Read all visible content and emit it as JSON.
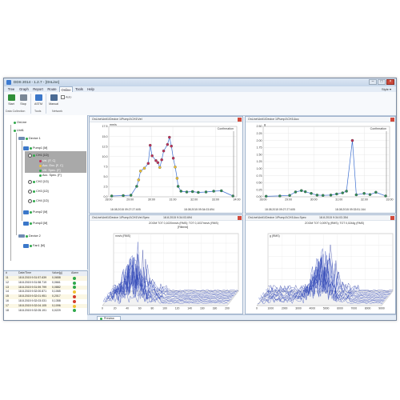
{
  "window": {
    "title": "DDS 2014 - 1.2.7 - [OnLine]",
    "controls": {
      "minimize": "–",
      "maximize": "□",
      "close": "×"
    }
  },
  "menu": {
    "tabs": [
      "Tree",
      "Graph",
      "Report",
      "Route",
      "Online",
      "Tools",
      "Help"
    ],
    "active": "Online",
    "style_label": "Style"
  },
  "ribbon": {
    "buttons": [
      {
        "label": "Start",
        "icon": "play-icon",
        "color": "#2f8f3a"
      },
      {
        "label": "Stop",
        "icon": "stop-icon",
        "color": "#7a8796"
      },
      {
        "label": "ASTM",
        "icon": "astm-icon",
        "color": "#3b77c9"
      },
      {
        "label": "Manual",
        "icon": "manual-icon",
        "color": "#4a6b94"
      }
    ],
    "auto_label": "Auto",
    "groups": [
      "Data Collection",
      "Tools",
      "Network"
    ]
  },
  "tree": {
    "nodes": [
      {
        "label": "OnLine",
        "level": 0
      },
      {
        "label": "Unit1",
        "level": 1
      },
      {
        "label": "Device 1",
        "level": 2
      },
      {
        "label": "Pump1 [M]",
        "level": 3
      },
      {
        "label": "CH1 [1D]",
        "level": 4
      },
      {
        "label": "Vel. [F, C]",
        "level": 5
      },
      {
        "label": "Acc. Env. [F, C]",
        "level": 5
      },
      {
        "label": "Vel. Spec. [F]",
        "level": 5
      },
      {
        "label": "Acc. Spec. [F]",
        "level": 5
      },
      {
        "label": "CH2 [1D]",
        "level": 4
      },
      {
        "label": "CH3 [1D]",
        "level": 4
      },
      {
        "label": "CH4 [1D]",
        "level": 4
      },
      {
        "label": "Pump2 [M]",
        "level": 3
      },
      {
        "label": "Pump3 [M]",
        "level": 3
      },
      {
        "label": "Device 2",
        "level": 2
      },
      {
        "label": "Fan1 [M]",
        "level": 3
      }
    ]
  },
  "alarm_table": {
    "headers": [
      "#",
      "Date/Time",
      "Value[g]",
      "Alarm"
    ],
    "rows": [
      {
        "n": "11",
        "time": "18.8.2015 9:31:57.639",
        "value": "0,0658",
        "color": "#2fa84a"
      },
      {
        "n": "12",
        "time": "18.8.2015 9:31:58.719",
        "value": "0,0661",
        "color": "#2fa84a"
      },
      {
        "n": "13",
        "time": "18.8.2015 9:31:59.799",
        "value": "0,0882",
        "color": "#2fa84a"
      },
      {
        "n": "14",
        "time": "18.8.2015 9:32:00.871",
        "value": "0,1065",
        "color": "#f1c232"
      },
      {
        "n": "15",
        "time": "18.8.2015 9:32:01.951",
        "value": "0,2017",
        "color": "#d33a2c"
      },
      {
        "n": "16",
        "time": "18.8.2015 9:32:03.031",
        "value": "0,1358",
        "color": "#d33a2c"
      },
      {
        "n": "17",
        "time": "18.8.2015 9:32:04.105",
        "value": "0,1096",
        "color": "#f1c232"
      },
      {
        "n": "18",
        "time": "18.8.2015 9:32:05.191",
        "value": "0,0229",
        "color": "#2fa84a"
      }
    ]
  },
  "panels": {
    "vel_trend": {
      "title": "OnLine\\Unit1\\Device 1\\Pump1\\CH1\\Vel",
      "from": "18.08.2015 09:27:27.605",
      "to": "18.08.2015 09:34:03.694",
      "annotation": "Confirmation"
    },
    "acc_trend": {
      "title": "OnLine\\Unit1\\Device 1\\Pump1\\CH1\\Acc",
      "from": "18.08.2015 09:27:27.605",
      "to": "18.08.2015 09:33:51.164",
      "annotation": "Confirmation"
    },
    "vel_spec": {
      "title": "OnLine\\Unit1\\Device 1\\Pump1\\CH1\\Vel.Spec",
      "stamp": "18.8.2015 9:34:03.694",
      "info": "ZOOM TOT 0,1020mm/s (RMS); TOT 0,1037mm/s (RMS)",
      "info2": "[Filtered]"
    },
    "acc_spec": {
      "title": "OnLine\\Unit1\\Device 1\\Pump1\\CH1\\Acc.Spec",
      "stamp": "18.8.2015 9:34:03.354",
      "info": "ZOOM TOT 0,0097g (RMS); TOT 0,0244g (RMS)"
    }
  },
  "bottom_tab": "Preview",
  "chart_data": [
    {
      "type": "scatter",
      "title": "OnLine\\Unit1\\Device 1\\Pump1\\CH1\\Vel",
      "ylabel": "mm/s",
      "xlabel": "",
      "x_ticks": [
        "28:00",
        "29:00",
        "30:00",
        "31:00",
        "32:00",
        "33:00",
        "34:00"
      ],
      "y_ticks": [
        "0.0",
        "2.5",
        "5.0",
        "7.5",
        "10.0",
        "12.5",
        "15.0",
        "17.5"
      ],
      "xlim": [
        27.45,
        34.1
      ],
      "ylim": [
        0,
        17.5
      ],
      "grid": true,
      "points": [
        [
          27.6,
          0.2
        ],
        [
          28.2,
          0.3
        ],
        [
          28.6,
          0.4
        ],
        [
          28.9,
          2.6
        ],
        [
          29.0,
          4.2
        ],
        [
          29.1,
          6.4
        ],
        [
          29.3,
          7.1
        ],
        [
          29.5,
          8.3
        ],
        [
          29.6,
          12.8
        ],
        [
          29.7,
          10.2
        ],
        [
          29.9,
          9.0
        ],
        [
          30.0,
          8.5
        ],
        [
          30.1,
          7.3
        ],
        [
          30.2,
          9.2
        ],
        [
          30.3,
          11.4
        ],
        [
          30.5,
          13.0
        ],
        [
          30.6,
          14.8
        ],
        [
          30.7,
          12.6
        ],
        [
          30.8,
          9.6
        ],
        [
          30.9,
          7.4
        ],
        [
          31.0,
          4.6
        ],
        [
          31.05,
          2.6
        ],
        [
          31.2,
          1.4
        ],
        [
          31.5,
          1.2
        ],
        [
          31.8,
          1.3
        ],
        [
          32.1,
          1.1
        ],
        [
          32.5,
          1.2
        ],
        [
          32.9,
          1.4
        ],
        [
          33.3,
          1.5
        ],
        [
          33.9,
          0.2
        ]
      ],
      "marker_colors": {
        "ok": "#2e8b57",
        "warning": "#f1c232",
        "alarm": "#c0305a"
      }
    },
    {
      "type": "scatter",
      "title": "OnLine\\Unit1\\Device 1\\Pump1\\CH1\\Acc",
      "ylabel": "g",
      "xlabel": "",
      "x_ticks": [
        "28:00",
        "29:00",
        "30:00",
        "31:00",
        "32:00",
        "33:00"
      ],
      "y_ticks": [
        "0.00",
        "0.25",
        "0.50",
        "0.75",
        "1.00",
        "1.25",
        "1.50",
        "1.75",
        "2.00",
        "2.25",
        "2.50"
      ],
      "xlim": [
        27.45,
        33.9
      ],
      "ylim": [
        0,
        2.5
      ],
      "grid": true,
      "points": [
        [
          27.6,
          0.02
        ],
        [
          28.3,
          0.03
        ],
        [
          28.8,
          0.05
        ],
        [
          29.1,
          0.17
        ],
        [
          29.4,
          0.22
        ],
        [
          29.6,
          0.18
        ],
        [
          29.9,
          0.12
        ],
        [
          30.2,
          0.06
        ],
        [
          30.5,
          0.05
        ],
        [
          30.9,
          0.06
        ],
        [
          31.2,
          0.1
        ],
        [
          31.5,
          0.14
        ],
        [
          31.7,
          0.2
        ],
        [
          32.0,
          2.0
        ],
        [
          32.2,
          0.07
        ],
        [
          32.6,
          0.12
        ],
        [
          32.9,
          0.08
        ],
        [
          33.2,
          0.16
        ],
        [
          33.7,
          0.03
        ]
      ]
    },
    {
      "type": "area",
      "title": "OnLine\\Unit1\\Device 1\\Pump1\\CH1\\Vel.Spec",
      "ylabel": "mm/s (RMS)",
      "xlabel": "",
      "x_ticks": [
        "0",
        "20",
        "40",
        "60",
        "80",
        "100",
        "120",
        "140",
        "160",
        "180",
        "200"
      ],
      "y_ticks": [
        "0",
        "0.01",
        "0.02",
        "0.03",
        "0.04",
        "0.05",
        "0.06"
      ],
      "xlim": [
        0,
        200
      ],
      "ylim": [
        0,
        0.06
      ],
      "grid": true,
      "spectrum_waterfall": true,
      "peak_x": 40,
      "peak_y": 0.055
    },
    {
      "type": "area",
      "title": "OnLine\\Unit1\\Device 1\\Pump1\\CH1\\Acc.Spec",
      "ylabel": "g (RMS)",
      "xlabel": "",
      "x_ticks": [
        "0",
        "1000",
        "2000",
        "3000",
        "4000",
        "5000",
        "6000",
        "7000",
        "8000",
        "9000"
      ],
      "y_ticks": [
        "0",
        "0.002",
        "0.004",
        "0.006",
        "0.008",
        "0.010"
      ],
      "xlim": [
        0,
        9000
      ],
      "ylim": [
        0,
        0.01
      ],
      "grid": true,
      "spectrum_waterfall": true,
      "peak_x": 4300,
      "peak_y": 0.0085
    }
  ]
}
